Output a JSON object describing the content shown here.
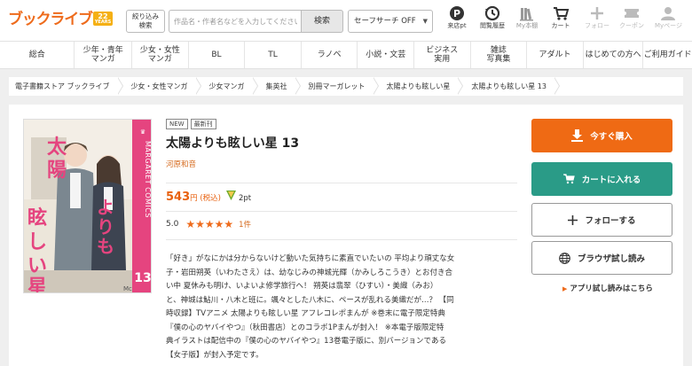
{
  "header": {
    "logo_text": "ブックライブ",
    "logo_badge_number": "22",
    "logo_badge_sub": "YEARS",
    "filter_label_line1": "絞り込み",
    "filter_label_line2": "検索",
    "search_placeholder": "作品名・作者名などを入力してください",
    "search_button": "検索",
    "safe_search": "セーフサーチ OFF",
    "icons": {
      "raiten": "来店pt",
      "history": "閲覧履歴",
      "bookshelf": "My本棚",
      "cart": "カート",
      "follow": "フォロー",
      "coupon": "クーポン",
      "mypage": "Myページ"
    }
  },
  "nav": {
    "items": [
      {
        "line1": "総合",
        "line2": ""
      },
      {
        "line1": "少年・青年",
        "line2": "マンガ"
      },
      {
        "line1": "少女・女性",
        "line2": "マンガ"
      },
      {
        "line1": "BL",
        "line2": ""
      },
      {
        "line1": "TL",
        "line2": ""
      },
      {
        "line1": "ラノベ",
        "line2": ""
      },
      {
        "line1": "小説・文芸",
        "line2": ""
      },
      {
        "line1": "ビジネス",
        "line2": "実用"
      },
      {
        "line1": "雑誌",
        "line2": "写真集"
      },
      {
        "line1": "アダルト",
        "line2": ""
      },
      {
        "line1": "はじめての方へ",
        "line2": ""
      },
      {
        "line1": "ご利用ガイド",
        "line2": ""
      }
    ]
  },
  "breadcrumb": [
    "電子書籍ストア ブックライブ",
    "少女・女性マンガ",
    "少女マンガ",
    "集英社",
    "別冊マーガレット",
    "太陽よりも眩しい星",
    "太陽よりも眩しい星 13"
  ],
  "book": {
    "cover_title_vertical": "太陽よりも眩しい星",
    "cover_label": "MARGARET COMICS",
    "cover_volume": "13",
    "cover_publisher_mark": "Mc",
    "tags": [
      "NEW",
      "最新刊"
    ],
    "title": "太陽よりも眩しい星 13",
    "author": "河原和音",
    "price": "543",
    "price_unit": "円 (税込)",
    "points": "2pt",
    "rating": "5.0",
    "stars": "★★★★★",
    "review_count": "1件",
    "description_lines": [
      "「好き」がなにかは分からないけど動いた気持ちに素直でいたいの 平均より頑丈な女",
      "子・岩田朔英（いわたさえ）は、幼なじみの神城光輝（かみしろこうき）とお付き合",
      "い中 夏休みも明け、いよいよ修学旅行へ！ 朔英は翡翠（ひすい）・美織（みお）",
      "と、神城は鮎川・八木と班に。颯々とした八木に、ペースが乱れる美織だが…？ 【同",
      "時収録】TVアニメ 太陽よりも眩しい星 アフレコレポまんが ※巻末に電子限定特典",
      "『僕の心のヤバイやつ』（秋田書店）とのコラボ1Pまんが封入！ ※本電子版限定特",
      "典イラストは配信中の『僕の心のヤバイやつ』13巻電子版に、別バージョンである",
      "【女子版】が封入予定です。"
    ]
  },
  "actions": {
    "buy_now": "今すぐ購入",
    "add_cart": "カートに入れる",
    "follow": "フォローする",
    "browser_trial": "ブラウザ試し読み",
    "app_trial": "アプリ試し読みはこちら"
  },
  "colors": {
    "brand_orange": "#ee6b1c",
    "buy_button": "#ef6a14",
    "cart_button": "#2a9b87",
    "cover_pink": "#e5447f"
  }
}
